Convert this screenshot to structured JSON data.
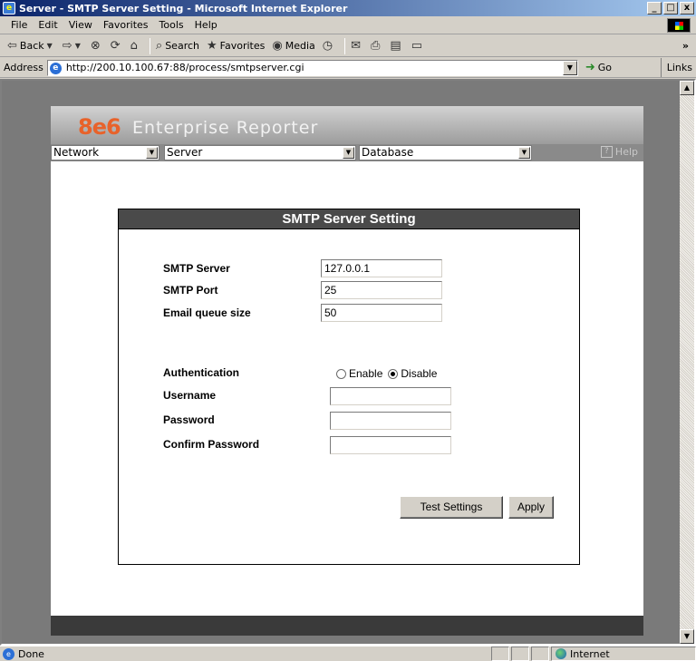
{
  "window": {
    "title": "Server - SMTP Server Setting - Microsoft Internet Explorer",
    "minimize": "_",
    "maximize": "□",
    "close": "x"
  },
  "menu": [
    {
      "label": "File"
    },
    {
      "label": "Edit"
    },
    {
      "label": "View"
    },
    {
      "label": "Favorites"
    },
    {
      "label": "Tools"
    },
    {
      "label": "Help"
    }
  ],
  "toolbar": {
    "back": "Back",
    "search": "Search",
    "favorites": "Favorites",
    "media": "Media",
    "more": "»"
  },
  "address": {
    "label": "Address",
    "url": "http://200.10.100.67:88/process/smtpserver.cgi",
    "go": "Go",
    "links": "Links"
  },
  "app": {
    "logo": "8e6",
    "brand": "Enterprise Reporter",
    "nav": [
      {
        "label": "Network"
      },
      {
        "label": "Server"
      },
      {
        "label": "Database"
      }
    ],
    "help": "Help"
  },
  "form": {
    "title": "SMTP Server Setting",
    "smtp_server_label": "SMTP Server",
    "smtp_server_value": "127.0.0.1",
    "smtp_port_label": "SMTP Port",
    "smtp_port_value": "25",
    "queue_label": "Email queue size",
    "queue_value": "50",
    "auth_label": "Authentication",
    "auth_enable": "Enable",
    "auth_disable": "Disable",
    "auth_selected": "Disable",
    "username_label": "Username",
    "username_value": "",
    "password_label": "Password",
    "password_value": "",
    "confirm_label": "Confirm Password",
    "confirm_value": "",
    "test_button": "Test Settings",
    "apply_button": "Apply"
  },
  "status": {
    "text": "Done",
    "zone": "Internet"
  }
}
